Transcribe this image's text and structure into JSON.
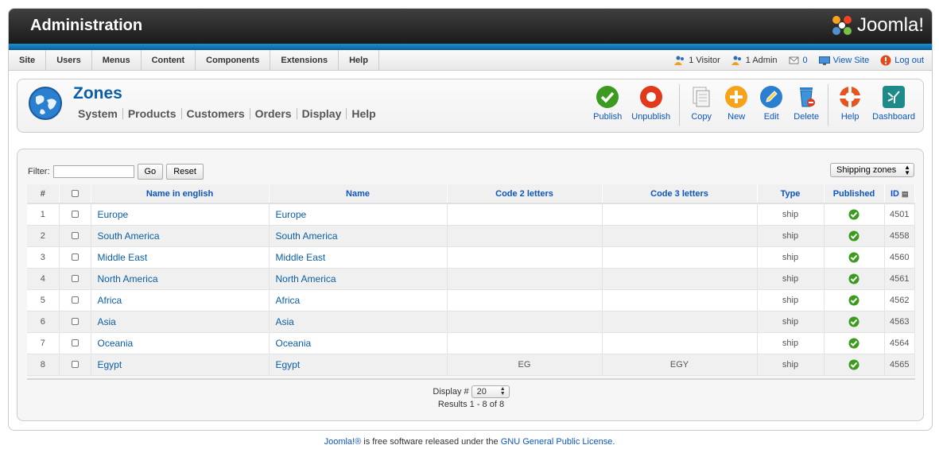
{
  "header": {
    "title": "Administration",
    "brand": "Joomla!"
  },
  "menu": [
    "Site",
    "Users",
    "Menus",
    "Content",
    "Components",
    "Extensions",
    "Help"
  ],
  "status": {
    "visitors": "1 Visitor",
    "admins": "1 Admin",
    "messages": "0",
    "view_site": "View Site",
    "logout": "Log out"
  },
  "page": {
    "title": "Zones",
    "submenu": [
      "System",
      "Products",
      "Customers",
      "Orders",
      "Display",
      "Help"
    ]
  },
  "toolbar": {
    "publish": "Publish",
    "unpublish": "Unpublish",
    "copy": "Copy",
    "new": "New",
    "edit": "Edit",
    "delete": "Delete",
    "help": "Help",
    "dashboard": "Dashboard"
  },
  "filter": {
    "label": "Filter:",
    "value": "",
    "go": "Go",
    "reset": "Reset"
  },
  "zone_filter": {
    "selected": "Shipping zones"
  },
  "table": {
    "headers": {
      "num": "#",
      "name_en": "Name in english",
      "name": "Name",
      "code2": "Code 2 letters",
      "code3": "Code 3 letters",
      "type": "Type",
      "published": "Published",
      "id": "ID"
    },
    "rows": [
      {
        "num": "1",
        "name_en": "Europe",
        "name": "Europe",
        "code2": "",
        "code3": "",
        "type": "ship",
        "id": "4501"
      },
      {
        "num": "2",
        "name_en": "South America",
        "name": "South America",
        "code2": "",
        "code3": "",
        "type": "ship",
        "id": "4558"
      },
      {
        "num": "3",
        "name_en": "Middle East",
        "name": "Middle East",
        "code2": "",
        "code3": "",
        "type": "ship",
        "id": "4560"
      },
      {
        "num": "4",
        "name_en": "North America",
        "name": "North America",
        "code2": "",
        "code3": "",
        "type": "ship",
        "id": "4561"
      },
      {
        "num": "5",
        "name_en": "Africa",
        "name": "Africa",
        "code2": "",
        "code3": "",
        "type": "ship",
        "id": "4562"
      },
      {
        "num": "6",
        "name_en": "Asia",
        "name": "Asia",
        "code2": "",
        "code3": "",
        "type": "ship",
        "id": "4563"
      },
      {
        "num": "7",
        "name_en": "Oceania",
        "name": "Oceania",
        "code2": "",
        "code3": "",
        "type": "ship",
        "id": "4564"
      },
      {
        "num": "8",
        "name_en": "Egypt",
        "name": "Egypt",
        "code2": "EG",
        "code3": "EGY",
        "type": "ship",
        "id": "4565"
      }
    ]
  },
  "pagination": {
    "display_label": "Display #",
    "display_value": "20",
    "results": "Results 1 - 8 of 8"
  },
  "footer": {
    "brand_link": "Joomla!®",
    "text": " is free software released under the ",
    "license_link": "GNU General Public License",
    "end": "."
  },
  "colors": {
    "accent": "#0b5ea6",
    "header": "#2a2a2a",
    "strip": "#1a8fd3",
    "published": "#3c9a1f"
  }
}
